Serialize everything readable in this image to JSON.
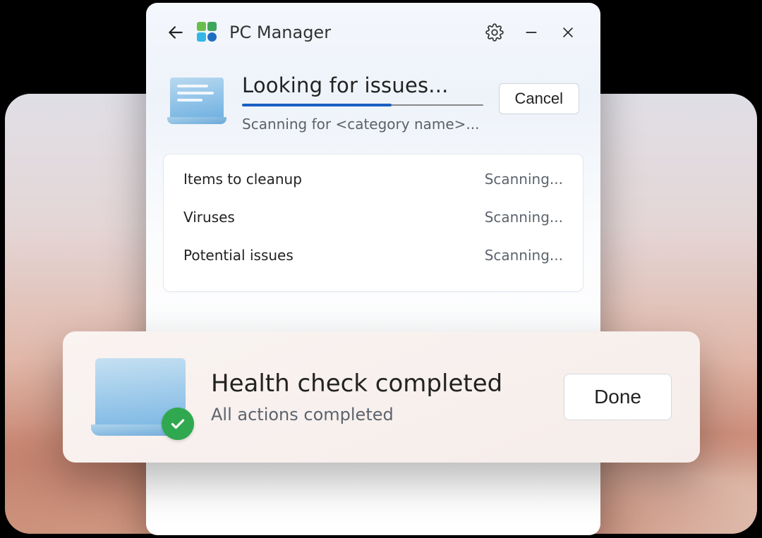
{
  "titlebar": {
    "app_name": "PC Manager"
  },
  "scan": {
    "title": "Looking for issues...",
    "subtitle": "Scanning for <category name>...",
    "progress_percent": 62,
    "cancel_label": "Cancel"
  },
  "list": {
    "items": [
      {
        "label": "Items to cleanup",
        "status": "Scanning..."
      },
      {
        "label": "Viruses",
        "status": "Scanning..."
      },
      {
        "label": "Potential issues",
        "status": "Scanning..."
      }
    ]
  },
  "done": {
    "title": "Health check completed",
    "subtitle": "All actions completed",
    "button_label": "Done"
  }
}
